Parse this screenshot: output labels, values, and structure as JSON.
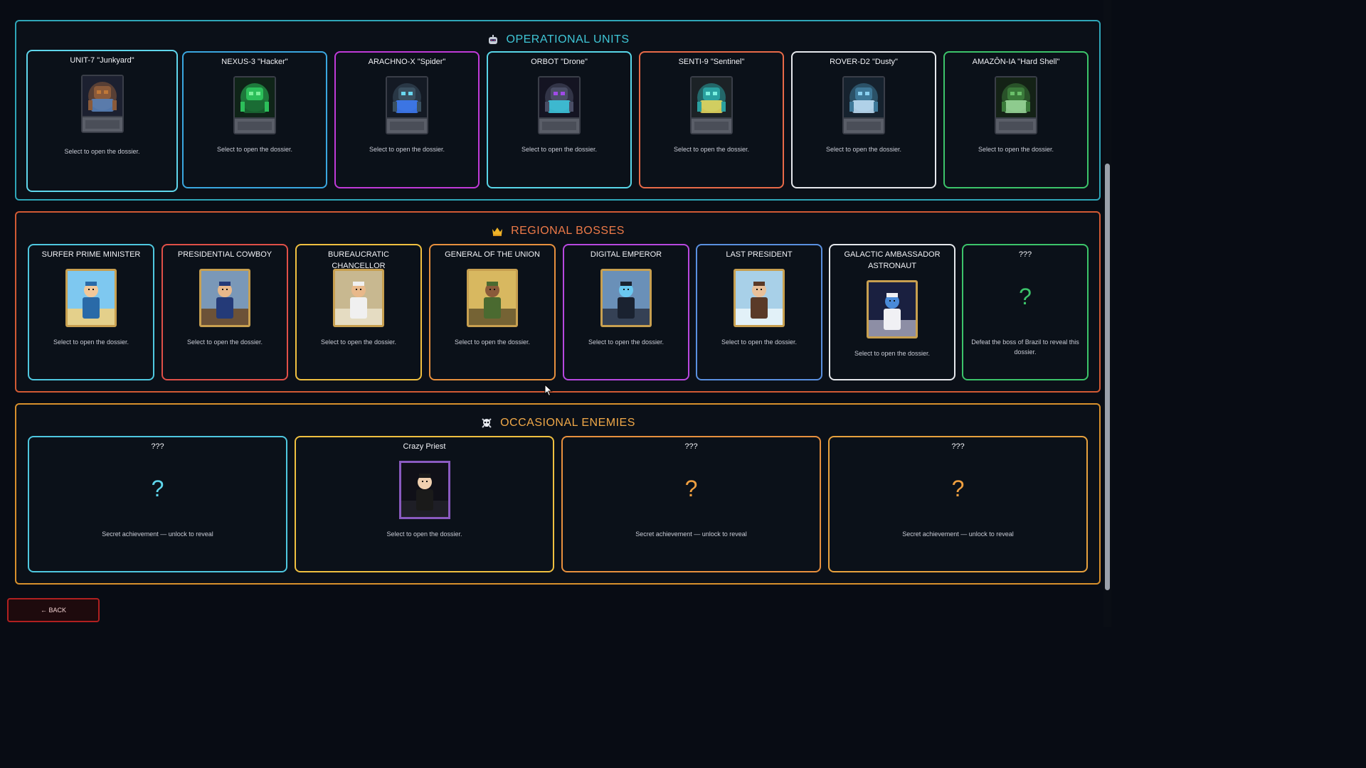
{
  "sections": {
    "units": {
      "title": "OPERATIONAL UNITS",
      "color": "#37b8c8",
      "cards": [
        {
          "name": "UNIT-7 \"Junkyard\"",
          "note": "Select to open the dossier.",
          "border": "#5fd6ec",
          "icon": "junkyard-robot-portrait"
        },
        {
          "name": "NEXUS-3 \"Hacker\"",
          "note": "Select to open the dossier.",
          "border": "#3aa7e0",
          "icon": "hacker-robot-portrait"
        },
        {
          "name": "ARACHNO-X \"Spider\"",
          "note": "Select to open the dossier.",
          "border": "#c03ad8",
          "icon": "spider-robot-portrait"
        },
        {
          "name": "ORBOT \"Drone\"",
          "note": "Select to open the dossier.",
          "border": "#58d6e8",
          "icon": "drone-robot-portrait"
        },
        {
          "name": "SENTI-9 \"Sentinel\"",
          "note": "Select to open the dossier.",
          "border": "#e86a48",
          "icon": "sentinel-robot-portrait"
        },
        {
          "name": "ROVER-D2 \"Dusty\"",
          "note": "Select to open the dossier.",
          "border": "#e6e8ec",
          "icon": "rover-robot-portrait"
        },
        {
          "name": "AMAZÔN-IA \"Hard Shell\"",
          "note": "Select to open the dossier.",
          "border": "#3cc46a",
          "icon": "hardshell-robot-portrait"
        }
      ]
    },
    "bosses": {
      "title": "REGIONAL BOSSES",
      "color": "#e8703e",
      "cards": [
        {
          "name": "SURFER PRIME MINISTER",
          "note": "Select to open the dossier.",
          "border": "#4fc8e0",
          "icon": "surfer-portrait"
        },
        {
          "name": "PRESIDENTIAL COWBOY",
          "note": "Select to open the dossier.",
          "border": "#e05048",
          "icon": "cowboy-portrait"
        },
        {
          "name": "BUREAUCRATIC CHANCELLOR",
          "note": "Select to open the dossier.",
          "border": "#f0c040",
          "icon": "chancellor-portrait"
        },
        {
          "name": "GENERAL OF THE UNION",
          "note": "Select to open the dossier.",
          "border": "#e8903e",
          "icon": "general-portrait"
        },
        {
          "name": "DIGITAL EMPEROR",
          "note": "Select to open the dossier.",
          "border": "#b848e0",
          "icon": "emperor-portrait"
        },
        {
          "name": "LAST PRESIDENT",
          "note": "Select to open the dossier.",
          "border": "#5a90e0",
          "icon": "president-portrait"
        },
        {
          "name": "GALACTIC AMBASSADOR ASTRONAUT",
          "note": "Select to open the dossier.",
          "border": "#e6e8ec",
          "icon": "astronaut-portrait"
        },
        {
          "name": "???",
          "note": "Defeat the boss of Brazil to reveal this dossier.",
          "border": "#3cc46a",
          "locked": "?",
          "icon": "question-mark-icon"
        }
      ]
    },
    "enemies": {
      "title": "OCCASIONAL ENEMIES",
      "color": "#e8a23e",
      "cards": [
        {
          "name": "???",
          "note": "Secret achievement — unlock to reveal",
          "border": "#4fc8e0",
          "locked": "?",
          "qcolor": "#5fd6ec"
        },
        {
          "name": "Crazy Priest",
          "note": "Select to open the dossier.",
          "border": "#f0c040",
          "icon": "crazy-priest-portrait"
        },
        {
          "name": "???",
          "note": "Secret achievement — unlock to reveal",
          "border": "#e8903e",
          "locked": "?",
          "qcolor": "#f0a040"
        },
        {
          "name": "???",
          "note": "Secret achievement — unlock to reveal",
          "border": "#e8a23e",
          "locked": "?",
          "qcolor": "#f0a040"
        }
      ]
    }
  },
  "back_label": "← BACK"
}
